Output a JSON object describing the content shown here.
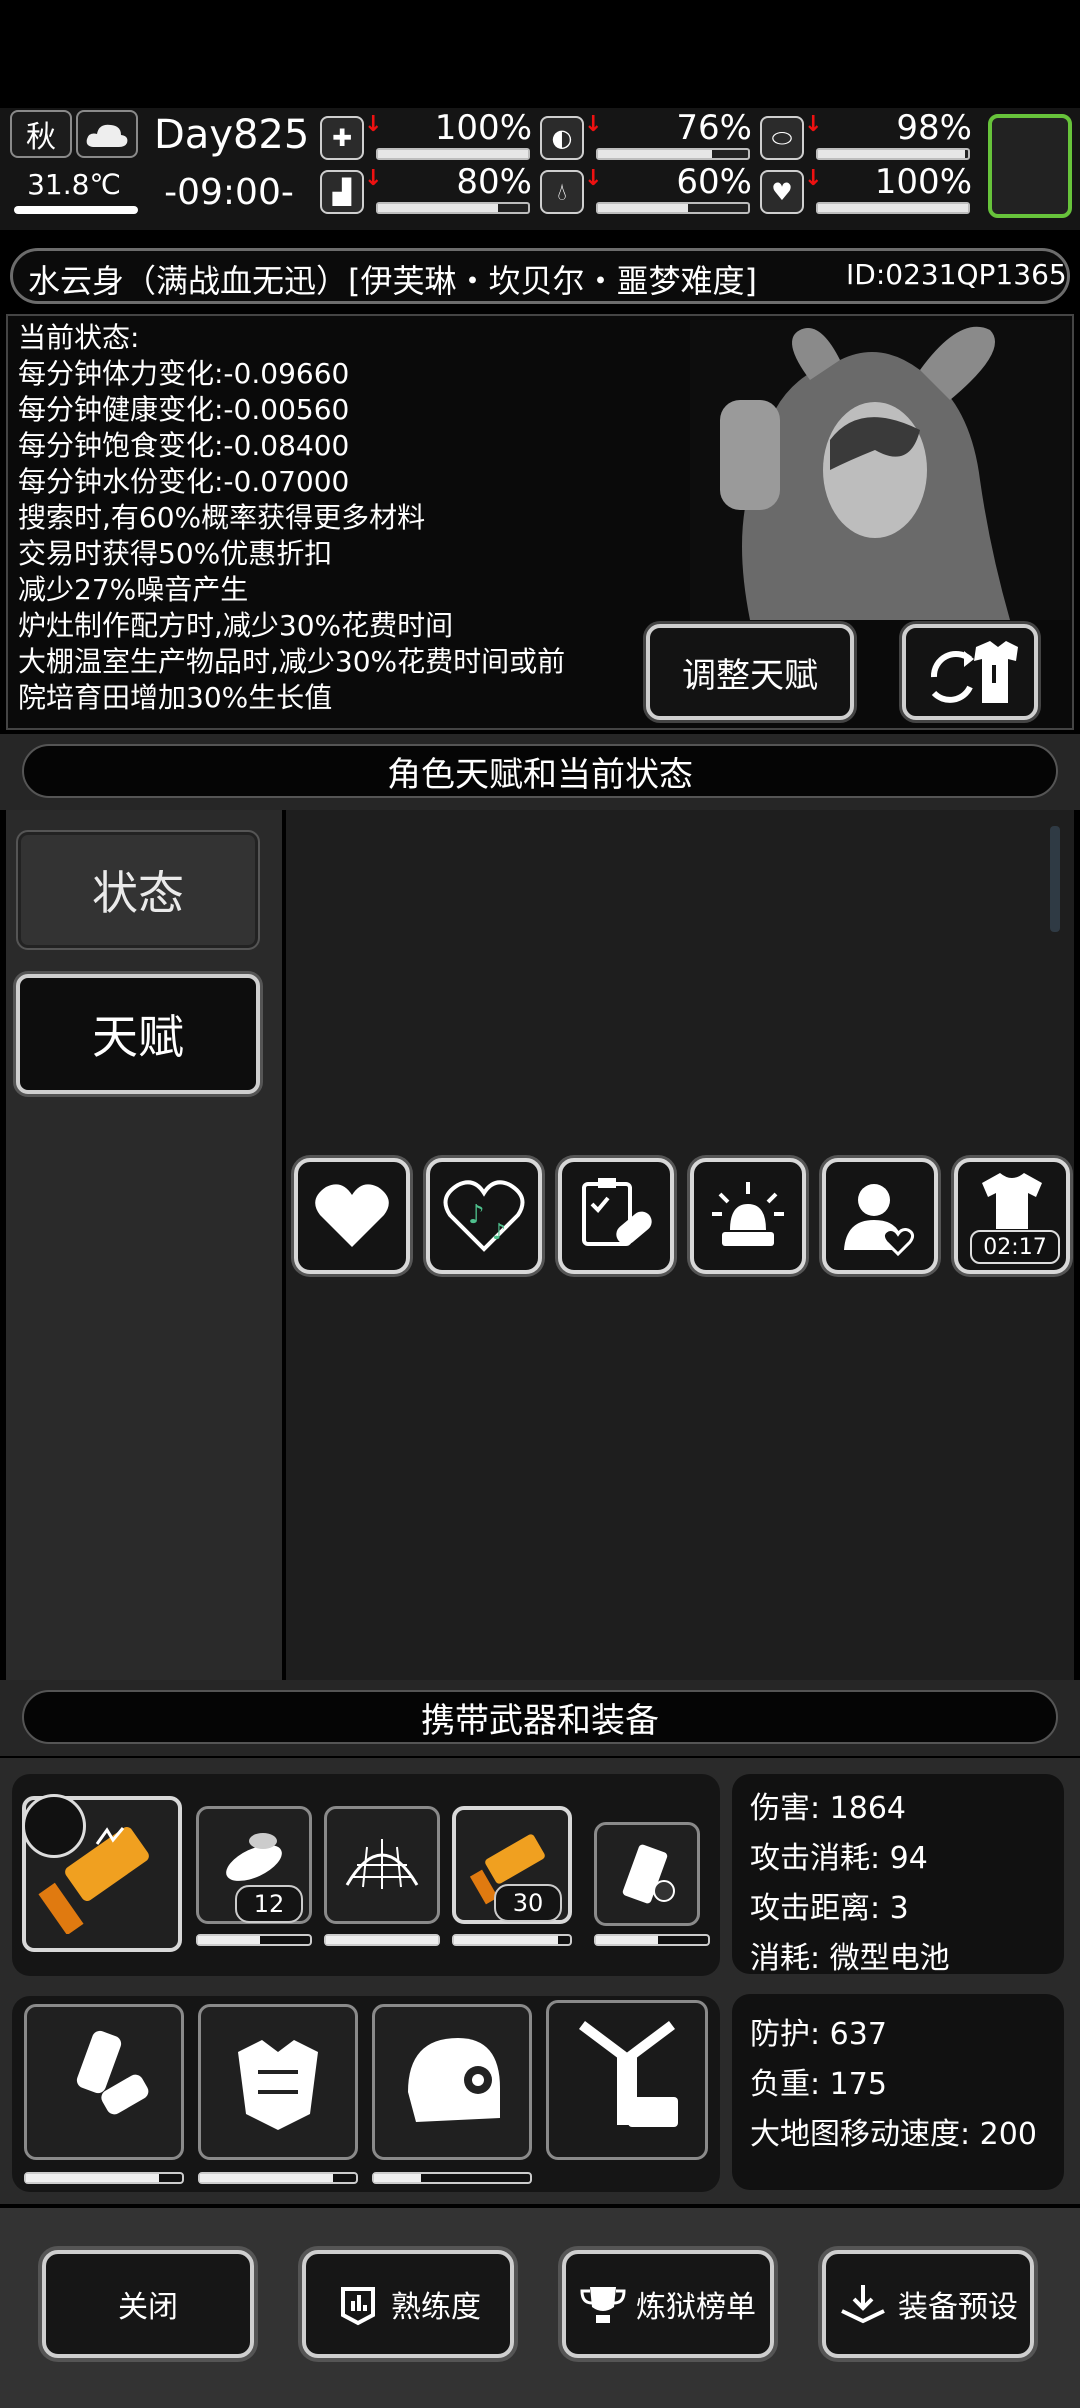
{
  "hud": {
    "season": "秋",
    "temperature": "31.8℃",
    "day": "Day825",
    "time": "-09:00-",
    "stats": [
      {
        "icon": "medkit-icon",
        "value": "100%",
        "fill": 1.0
      },
      {
        "icon": "stomach-icon",
        "value": "76%",
        "fill": 0.76
      },
      {
        "icon": "pill-icon",
        "value": "98%",
        "fill": 0.98
      },
      {
        "icon": "boot-icon",
        "value": "80%",
        "fill": 0.8
      },
      {
        "icon": "water-drop-icon",
        "value": "60%",
        "fill": 0.6
      },
      {
        "icon": "heart-icon",
        "value": "100%",
        "fill": 1.0
      }
    ]
  },
  "character": {
    "name": "水云身（满战血无迅）[伊芙琳・坎贝尔・噩梦难度]",
    "id": "ID:0231QP1365",
    "status_title": "当前状态:",
    "status_lines": [
      "每分钟体力变化:-0.09660",
      "每分钟健康变化:-0.00560",
      "每分钟饱食变化:-0.08400",
      "每分钟水份变化:-0.07000",
      "搜索时,有60%概率获得更多材料",
      "交易时获得50%优惠折扣",
      "减少27%噪音产生",
      "炉灶制作配方时,减少30%花费时间",
      "大棚温室生产物品时,减少30%花费时间或前",
      "院培育田增加30%生长值"
    ],
    "adjust_talent_label": "调整天赋"
  },
  "talent_section": {
    "title": "角色天赋和当前状态",
    "tabs": {
      "state": "状态",
      "talent": "天赋"
    },
    "timer": "02:17"
  },
  "equipment": {
    "title": "携带武器和装备",
    "slot_counts": {
      "second": "12",
      "fourth": "30"
    },
    "weapon_stats": [
      "伤害: 1864",
      "攻击消耗: 94",
      "攻击距离: 3",
      "消耗: 微型电池"
    ],
    "armor_stats": [
      "防护: 637",
      "负重: 175",
      "大地图移动速度: 200"
    ],
    "weapon_durability": [
      0.55,
      1.0,
      0.9,
      0.55
    ],
    "armor_durability": [
      0.85,
      0.85,
      0.3
    ]
  },
  "bottom": {
    "close": "关闭",
    "proficiency": "熟练度",
    "ranking": "炼狱榜单",
    "preset": "装备预设"
  }
}
